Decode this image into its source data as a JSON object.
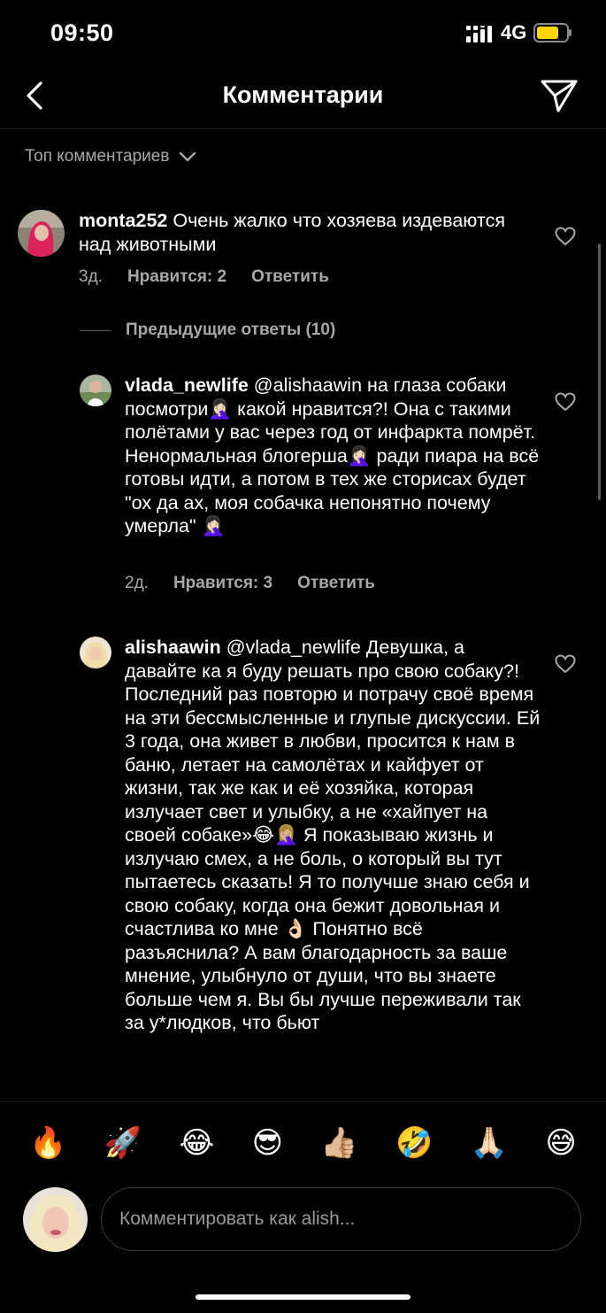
{
  "status": {
    "time": "09:50",
    "network": "4G"
  },
  "header": {
    "title": "Комментарии"
  },
  "sort": {
    "label": "Топ комментариев"
  },
  "comments": [
    {
      "user": "monta252",
      "text": " Очень жалко что хозяева издеваются над животными",
      "age": "3д.",
      "likes": "Нравится: 2",
      "reply": "Ответить"
    },
    {
      "user": "vlada_newlife",
      "text": " @alishaawin на глаза собаки посмотри🤦🏻‍♀️ какой нравится?! Она с такими полётами у вас через год от инфаркта помрёт. Ненормальная блогерша🤦🏻‍♀️ ради пиара на всё готовы идти, а потом в тех же сторисах будет \"ох да ах, моя собачка непонятно почему умерла\" 🤦🏻‍♀️",
      "age": "2д.",
      "likes": "Нравится: 3",
      "reply": "Ответить"
    },
    {
      "user": "alishaawin",
      "text": " @vlada_newlife Девушка, а давайте ка я буду решать про свою собаку?! Последний раз повторю и потрачу своё время на эти бессмысленные и глупые дискуссии. Ей 3 года, она живет в любви, просится к нам в баню, летает на самолётах и кайфует от жизни, так же как и её хозяйка, которая излучает свет и улыбку, а не «хайпует на своей собаке»😂🤦🏼‍♀️ Я показываю жизнь и излучаю смех, а не боль, о который вы тут пытаетесь сказать! Я то получше знаю себя и свою собаку, когда она бежит довольная и счастлива ко мне 👌🏻 Понятно всё разъяснила? А вам благодарность за ваше мнение, улыбнуло от души, что вы знаете больше чем я. Вы бы лучше переживали так за у*людков, что бьют"
    }
  ],
  "previous_replies": "Предыдущие ответы (10)",
  "emojis": [
    "🔥",
    "🚀",
    "😂",
    "😎",
    "👍🏼",
    "🤣",
    "🙏🏻",
    "😅"
  ],
  "input": {
    "placeholder": "Комментировать как alish..."
  }
}
